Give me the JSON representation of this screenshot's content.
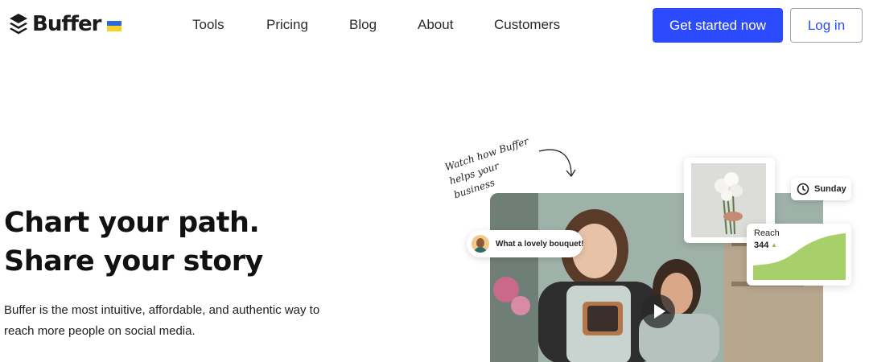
{
  "brand": {
    "name": "Buffer",
    "flag_colors": [
      "#2a6bd8",
      "#f7d12a"
    ]
  },
  "nav": {
    "items": [
      {
        "label": "Tools"
      },
      {
        "label": "Pricing"
      },
      {
        "label": "Blog"
      },
      {
        "label": "About"
      },
      {
        "label": "Customers"
      }
    ]
  },
  "header": {
    "cta_label": "Get started now",
    "login_label": "Log in"
  },
  "hero": {
    "headline_line1": "Chart your path.",
    "headline_line2": "Share your story",
    "subtext": "Buffer is the most intuitive, affordable, and authentic way to reach more people on social media."
  },
  "visual": {
    "handwritten_line1": "Watch how Buffer",
    "handwritten_line2": "helps your business",
    "comment_text": "What a lovely bouquet!",
    "schedule_day": "Sunday",
    "reach_label": "Reach",
    "reach_value": "344",
    "reach_trend": "▲"
  },
  "colors": {
    "primary": "#2c4bff",
    "reach_fill": "#a7cf6a"
  },
  "icons": {
    "logo": "buffer-stack-logo",
    "clock": "clock-icon",
    "play": "play-icon",
    "arrow": "curved-arrow"
  }
}
